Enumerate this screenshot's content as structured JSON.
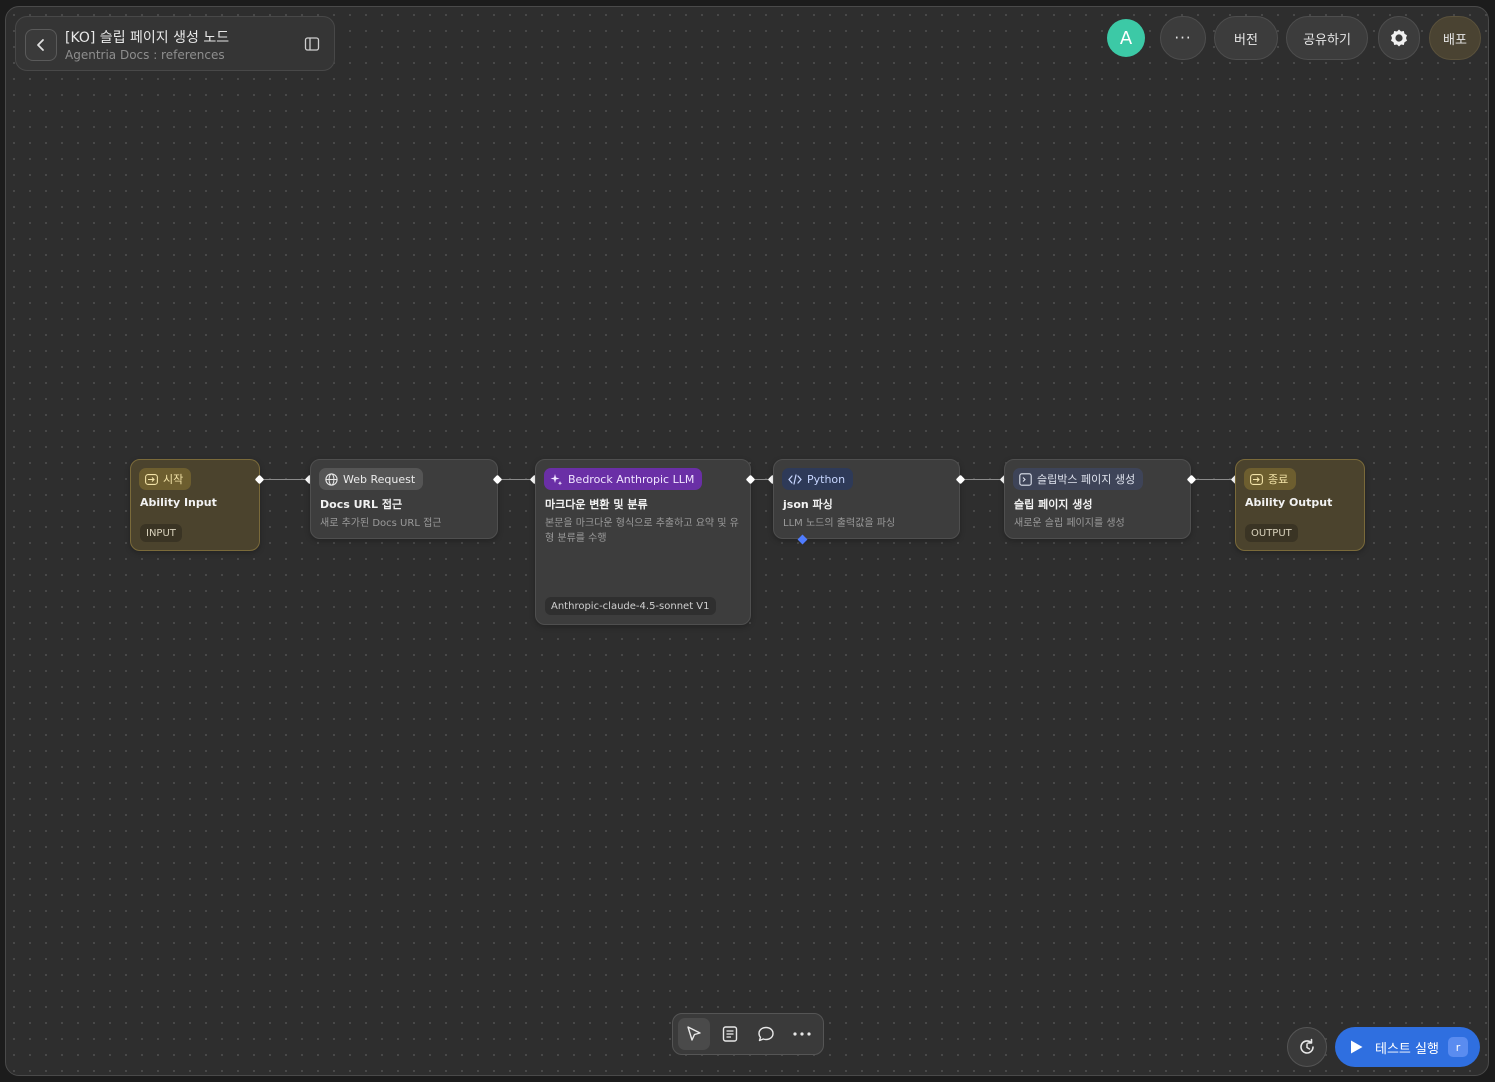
{
  "header": {
    "title": "[KO] 슬립 페이지 생성 노드",
    "subtitle": "Agentria Docs : references",
    "avatar_letter": "A",
    "more_label": "···",
    "version_label": "버전",
    "share_label": "공유하기",
    "deploy_label": "배포"
  },
  "nodes": [
    {
      "badge": "시작",
      "title": "Ability Input",
      "tag": "INPUT",
      "icon": "login-icon"
    },
    {
      "badge": "Web Request",
      "title": "Docs URL 접근",
      "desc": "새로 추가된 Docs URL 접근",
      "icon": "globe-icon"
    },
    {
      "badge": "Bedrock Anthropic LLM",
      "title": "마크다운 변환 및 분류",
      "desc": "본문을 마크다운 형식으로 추출하고 요약 및 유형 분류를 수행",
      "tag": "Anthropic-claude-4.5-sonnet V1",
      "icon": "sparkle-icon"
    },
    {
      "badge": "Python",
      "title": "json 파싱",
      "desc": "LLM 노드의 출력값을 파싱",
      "icon": "code-icon"
    },
    {
      "badge": "슬립박스 페이지 생성",
      "title": "슬립 페이지 생성",
      "desc": "새로운 슬립 페이지를 생성",
      "icon": "page-icon"
    },
    {
      "badge": "종료",
      "title": "Ability Output",
      "tag": "OUTPUT",
      "icon": "logout-icon"
    }
  ],
  "bottom": {
    "run_label": "테스트 실행",
    "run_shortcut": "r"
  },
  "colors": {
    "accent": "#2f6fe0",
    "avatar": "#3cc9a6",
    "llm_badge": "#6a2fa6",
    "io_node": "#4b432d"
  }
}
